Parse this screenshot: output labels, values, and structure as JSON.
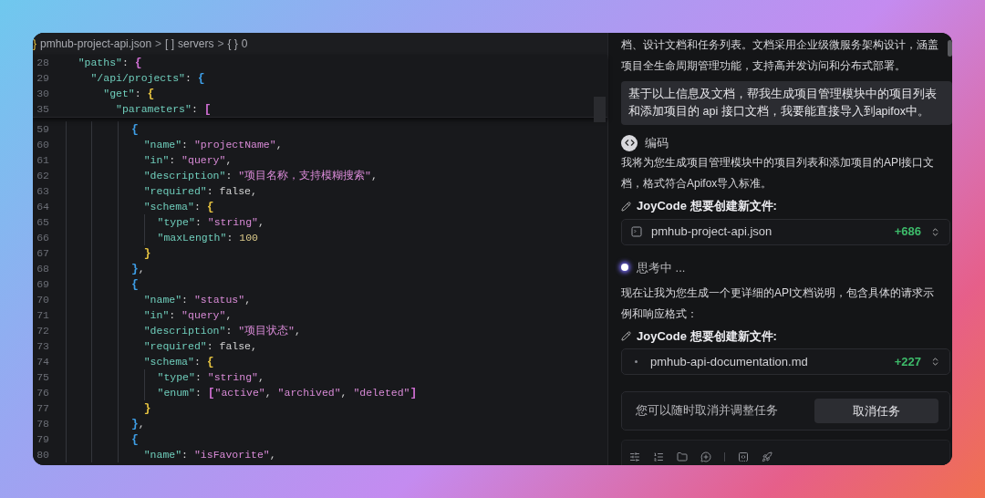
{
  "editor": {
    "breadcrumb": [
      {
        "icon": "}",
        "label": "pmhub-project-api.json"
      },
      {
        "separator": ">",
        "icon": "[ ]",
        "label": "servers"
      },
      {
        "separator": ">",
        "icon": "{ }",
        "label": "0"
      }
    ],
    "sticky_lines": [
      {
        "number": "28",
        "tokens": [
          {
            "kind": "key",
            "text": "    \"paths\""
          },
          {
            "kind": "punct",
            "text": ": "
          },
          {
            "kind": "bracket",
            "text": "{",
            "color": "#d06fd3"
          }
        ]
      },
      {
        "number": "29",
        "tokens": [
          {
            "kind": "key",
            "text": "      \"/api/projects\""
          },
          {
            "kind": "punct",
            "text": ": "
          },
          {
            "kind": "bracket",
            "text": "{",
            "color": "#3e9fe8"
          }
        ]
      },
      {
        "number": "30",
        "tokens": [
          {
            "kind": "key",
            "text": "        \"get\""
          },
          {
            "kind": "punct",
            "text": ": "
          },
          {
            "kind": "bracket",
            "text": "{",
            "color": "#e6c340"
          }
        ]
      },
      {
        "number": "35",
        "tokens": [
          {
            "kind": "key",
            "text": "          \"parameters\""
          },
          {
            "kind": "punct",
            "text": ": "
          },
          {
            "kind": "bracket",
            "text": "[",
            "color": "#d06fd3"
          }
        ]
      }
    ],
    "lines": [
      {
        "number": "59",
        "tokens": [
          {
            "kind": "bracket",
            "text": "            {",
            "color": "#3e9fe8"
          }
        ]
      },
      {
        "number": "60",
        "tokens": [
          {
            "kind": "key",
            "text": "              \"name\""
          },
          {
            "kind": "punct",
            "text": ": "
          },
          {
            "kind": "string",
            "text": "\"projectName\""
          },
          {
            "kind": "punct",
            "text": ","
          }
        ]
      },
      {
        "number": "61",
        "tokens": [
          {
            "kind": "key",
            "text": "              \"in\""
          },
          {
            "kind": "punct",
            "text": ": "
          },
          {
            "kind": "string",
            "text": "\"query\""
          },
          {
            "kind": "punct",
            "text": ","
          }
        ]
      },
      {
        "number": "62",
        "tokens": [
          {
            "kind": "key",
            "text": "              \"description\""
          },
          {
            "kind": "punct",
            "text": ": "
          },
          {
            "kind": "string",
            "text": "\"项目名称，支持模糊搜索\""
          },
          {
            "kind": "punct",
            "text": ","
          }
        ]
      },
      {
        "number": "63",
        "tokens": [
          {
            "kind": "key",
            "text": "              \"required\""
          },
          {
            "kind": "punct",
            "text": ": "
          },
          {
            "kind": "literal",
            "text": "false"
          },
          {
            "kind": "punct",
            "text": ","
          }
        ]
      },
      {
        "number": "64",
        "tokens": [
          {
            "kind": "key",
            "text": "              \"schema\""
          },
          {
            "kind": "punct",
            "text": ": "
          },
          {
            "kind": "bracket",
            "text": "{",
            "color": "#e6c340"
          }
        ]
      },
      {
        "number": "65",
        "tokens": [
          {
            "kind": "key",
            "text": "                \"type\""
          },
          {
            "kind": "punct",
            "text": ": "
          },
          {
            "kind": "string",
            "text": "\"string\""
          },
          {
            "kind": "punct",
            "text": ","
          }
        ]
      },
      {
        "number": "66",
        "tokens": [
          {
            "kind": "key",
            "text": "                \"maxLength\""
          },
          {
            "kind": "punct",
            "text": ": "
          },
          {
            "kind": "number",
            "text": "100"
          }
        ]
      },
      {
        "number": "67",
        "tokens": [
          {
            "kind": "bracket",
            "text": "              }",
            "color": "#e6c340"
          }
        ]
      },
      {
        "number": "68",
        "tokens": [
          {
            "kind": "bracket",
            "text": "            }",
            "color": "#3e9fe8"
          },
          {
            "kind": "punct",
            "text": ","
          }
        ]
      },
      {
        "number": "69",
        "tokens": [
          {
            "kind": "bracket",
            "text": "            {",
            "color": "#3e9fe8"
          }
        ]
      },
      {
        "number": "70",
        "tokens": [
          {
            "kind": "key",
            "text": "              \"name\""
          },
          {
            "kind": "punct",
            "text": ": "
          },
          {
            "kind": "string",
            "text": "\"status\""
          },
          {
            "kind": "punct",
            "text": ","
          }
        ]
      },
      {
        "number": "71",
        "tokens": [
          {
            "kind": "key",
            "text": "              \"in\""
          },
          {
            "kind": "punct",
            "text": ": "
          },
          {
            "kind": "string",
            "text": "\"query\""
          },
          {
            "kind": "punct",
            "text": ","
          }
        ]
      },
      {
        "number": "72",
        "tokens": [
          {
            "kind": "key",
            "text": "              \"description\""
          },
          {
            "kind": "punct",
            "text": ": "
          },
          {
            "kind": "string",
            "text": "\"项目状态\""
          },
          {
            "kind": "punct",
            "text": ","
          }
        ]
      },
      {
        "number": "73",
        "tokens": [
          {
            "kind": "key",
            "text": "              \"required\""
          },
          {
            "kind": "punct",
            "text": ": "
          },
          {
            "kind": "literal",
            "text": "false"
          },
          {
            "kind": "punct",
            "text": ","
          }
        ]
      },
      {
        "number": "74",
        "tokens": [
          {
            "kind": "key",
            "text": "              \"schema\""
          },
          {
            "kind": "punct",
            "text": ": "
          },
          {
            "kind": "bracket",
            "text": "{",
            "color": "#e6c340"
          }
        ]
      },
      {
        "number": "75",
        "tokens": [
          {
            "kind": "key",
            "text": "                \"type\""
          },
          {
            "kind": "punct",
            "text": ": "
          },
          {
            "kind": "string",
            "text": "\"string\""
          },
          {
            "kind": "punct",
            "text": ","
          }
        ]
      },
      {
        "number": "76",
        "tokens": [
          {
            "kind": "key",
            "text": "                \"enum\""
          },
          {
            "kind": "punct",
            "text": ": "
          },
          {
            "kind": "bracket",
            "text": "[",
            "color": "#d06fd3"
          },
          {
            "kind": "string",
            "text": "\"active\""
          },
          {
            "kind": "punct",
            "text": ", "
          },
          {
            "kind": "string",
            "text": "\"archived\""
          },
          {
            "kind": "punct",
            "text": ", "
          },
          {
            "kind": "string",
            "text": "\"deleted\""
          },
          {
            "kind": "bracket",
            "text": "]",
            "color": "#d06fd3"
          }
        ]
      },
      {
        "number": "77",
        "tokens": [
          {
            "kind": "bracket",
            "text": "              }",
            "color": "#e6c340"
          }
        ]
      },
      {
        "number": "78",
        "tokens": [
          {
            "kind": "bracket",
            "text": "            }",
            "color": "#3e9fe8"
          },
          {
            "kind": "punct",
            "text": ","
          }
        ]
      },
      {
        "number": "79",
        "tokens": [
          {
            "kind": "bracket",
            "text": "            {",
            "color": "#3e9fe8"
          }
        ]
      },
      {
        "number": "80",
        "tokens": [
          {
            "kind": "key",
            "text": "              \"name\""
          },
          {
            "kind": "punct",
            "text": ": "
          },
          {
            "kind": "string",
            "text": "\"isFavorite\""
          },
          {
            "kind": "punct",
            "text": ","
          }
        ]
      }
    ]
  },
  "chat": {
    "messages": [
      {
        "kind": "text",
        "text": "档、设计文档和任务列表。文档采用企业级微服务架构设计，涵盖项目全生命周期管理功能，支持高并发访问和分布式部署。"
      },
      {
        "kind": "user",
        "text": "基于以上信息及文档，帮我生成项目管理模块中的项目列表和添加项目的 api 接口文档，我要能直接导入到apifox中。"
      },
      {
        "kind": "step",
        "text": "编码"
      },
      {
        "kind": "text",
        "text": "我将为您生成项目管理模块中的项目列表和添加项目的API接口文档，格式符合Apifox导入标准。"
      },
      {
        "kind": "action",
        "text": "JoyCode 想要创建新文件:"
      },
      {
        "kind": "file",
        "name": "pmhub-project-api.json",
        "added": "+686"
      },
      {
        "kind": "thinking",
        "text": "思考中 ..."
      },
      {
        "kind": "text",
        "text": "现在让我为您生成一个更详细的API文档说明，包含具体的请求示例和响应格式："
      },
      {
        "kind": "action",
        "text": "JoyCode 想要创建新文件:"
      },
      {
        "kind": "file",
        "name": "pmhub-api-documentation.md",
        "added": "+227"
      }
    ],
    "cancel": {
      "text": "您可以随时取消并调整任务",
      "button": "取消任务"
    }
  }
}
